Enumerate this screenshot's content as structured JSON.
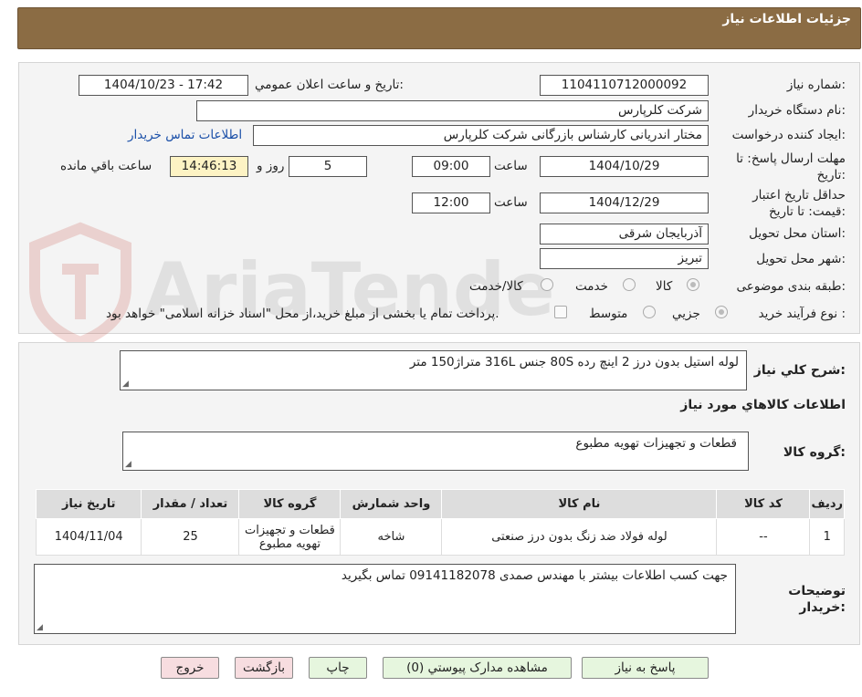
{
  "header": {
    "title": "جزئیات اطلاعات نیاز"
  },
  "watermark": {
    "text": "AriaTender.net"
  },
  "labels": {
    "need_number": "شماره نیاز:",
    "announce_datetime": "تاریخ و ساعت اعلان عمومي:",
    "buyer_org": "نام دستگاه خریدار:",
    "requester": "ایجاد کننده درخواست:",
    "contact_link": "اطلاعات تماس خریدار",
    "reply_deadline_line1": "مهلت ارسال پاسخ: تا",
    "reply_deadline_line2": "تاریخ:",
    "time_word": "ساعت",
    "days_word": "روز و",
    "remaining_word": "ساعت باقي مانده",
    "price_validity_line1": "حداقل تاریخ اعتبار",
    "price_validity_line2": "قیمت: تا تاریخ:",
    "delivery_province": "استان محل تحویل:",
    "delivery_city": "شهر محل تحویل:",
    "subject_category": "طبقه بندی موضوعی:",
    "process_type": "نوع فرآیند خرید :",
    "general_desc": "شرح کلي نیاز:",
    "goods_info": "اطلاعات کالاهاي مورد نیاز",
    "goods_group": "گروه کالا:",
    "buyer_notes_line1": "توضیحات",
    "buyer_notes_line2": "خریدار:"
  },
  "values": {
    "need_number": "1104110712000092",
    "announce_datetime": "1404/10/23 - 17:42",
    "buyer_org": "شرکت کلرپارس",
    "requester": "مختار اندریانی کارشناس بازرگانی شرکت کلرپارس",
    "reply_date": "1404/10/29",
    "reply_time": "09:00",
    "days": "5",
    "remaining_time": "14:46:13",
    "validity_date": "1404/12/29",
    "validity_time": "12:00",
    "province": "آذربایجان شرقی",
    "city": "تبریز",
    "general_desc": "لوله استیل بدون درز 2 اینچ رده 80S  جنس 316L  متراژ150 متر",
    "goods_group": "قطعات و تجهیزات تهویه مطبوع",
    "buyer_notes": "جهت کسب اطلاعات بیشتر با مهندس صمدی 09141182078 تماس بگیرید"
  },
  "category_options": [
    {
      "label": "کالا",
      "selected": true
    },
    {
      "label": "خدمت",
      "selected": false
    },
    {
      "label": "کالا/خدمت",
      "selected": false
    }
  ],
  "process_options": [
    {
      "label": "جزیي",
      "selected": true
    },
    {
      "label": "متوسط",
      "selected": false
    }
  ],
  "payment_note": "پرداخت تمام یا بخشی از مبلغ خرید،از محل \"اسناد خزانه اسلامی\" خواهد بود.",
  "table": {
    "headers": [
      "ردیف",
      "کد کالا",
      "نام کالا",
      "واحد شمارش",
      "گروه کالا",
      "تعداد / مقدار",
      "تاریخ نیاز"
    ],
    "rows": [
      [
        "1",
        "--",
        "لوله فولاد ضد زنگ بدون درز صنعتی",
        "شاخه",
        "قطعات و تجهیزات تهویه مطبوع",
        "25",
        "1404/11/04"
      ]
    ]
  },
  "buttons": {
    "reply": "پاسخ به نیاز",
    "attachments": "مشاهده مدارک پیوستي (0)",
    "print": "چاپ",
    "back": "بازگشت",
    "exit": "خروج"
  },
  "colors": {
    "header_bg": "#8b6c44",
    "timer_bg": "#fdf3c4",
    "link": "#1a4fa8",
    "btn_green": "#e6f6de",
    "btn_pink": "#f7dde0"
  }
}
